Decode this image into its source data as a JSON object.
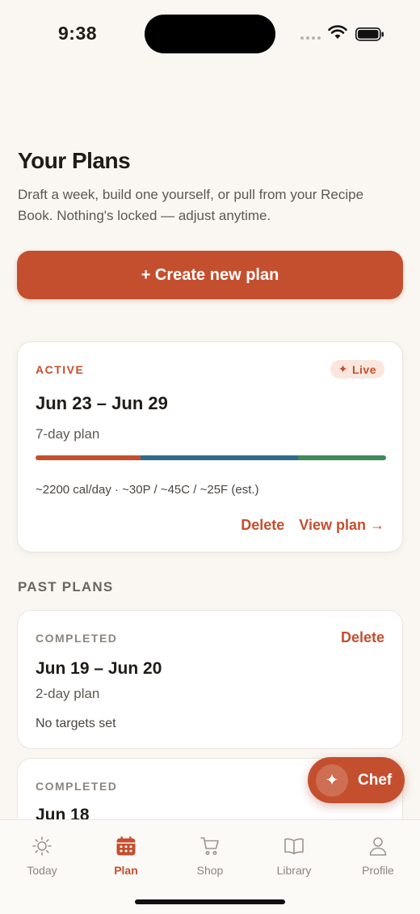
{
  "status": {
    "time": "9:38"
  },
  "header": {
    "title": "Your Plans",
    "description": "Draft a week, build one yourself, or pull from your Recipe Book. Nothing's locked — adjust anytime."
  },
  "create_button": {
    "label": "+ Create new plan"
  },
  "active_plan": {
    "status_label": "ACTIVE",
    "badge": "Live",
    "date_range": "Jun 23 – Jun 29",
    "length": "7-day plan",
    "macros_text": "~2200 cal/day · ~30P / ~45C / ~25F (est.)",
    "macro_split": {
      "protein": 30,
      "carbs": 45,
      "fat": 25
    },
    "delete_label": "Delete",
    "view_label": "View plan →"
  },
  "past_section": {
    "title": "PAST PLANS"
  },
  "past_plans": [
    {
      "status_label": "COMPLETED",
      "delete_label": "Delete",
      "date_range": "Jun 19 – Jun 20",
      "length": "2-day plan",
      "targets": "No targets set"
    },
    {
      "status_label": "COMPLETED",
      "date_range": "Jun 18"
    }
  ],
  "chef_button": {
    "label": "Chef"
  },
  "tabs": [
    {
      "label": "Today",
      "icon": "sun-icon"
    },
    {
      "label": "Plan",
      "icon": "calendar-icon",
      "active": true
    },
    {
      "label": "Shop",
      "icon": "cart-icon"
    },
    {
      "label": "Library",
      "icon": "book-icon"
    },
    {
      "label": "Profile",
      "icon": "person-icon"
    }
  ],
  "colors": {
    "accent": "#c44f2e",
    "protein": "#c44f2e",
    "carbs": "#2f6b8a",
    "fat": "#3d8a5a",
    "background": "#faf6f1"
  }
}
